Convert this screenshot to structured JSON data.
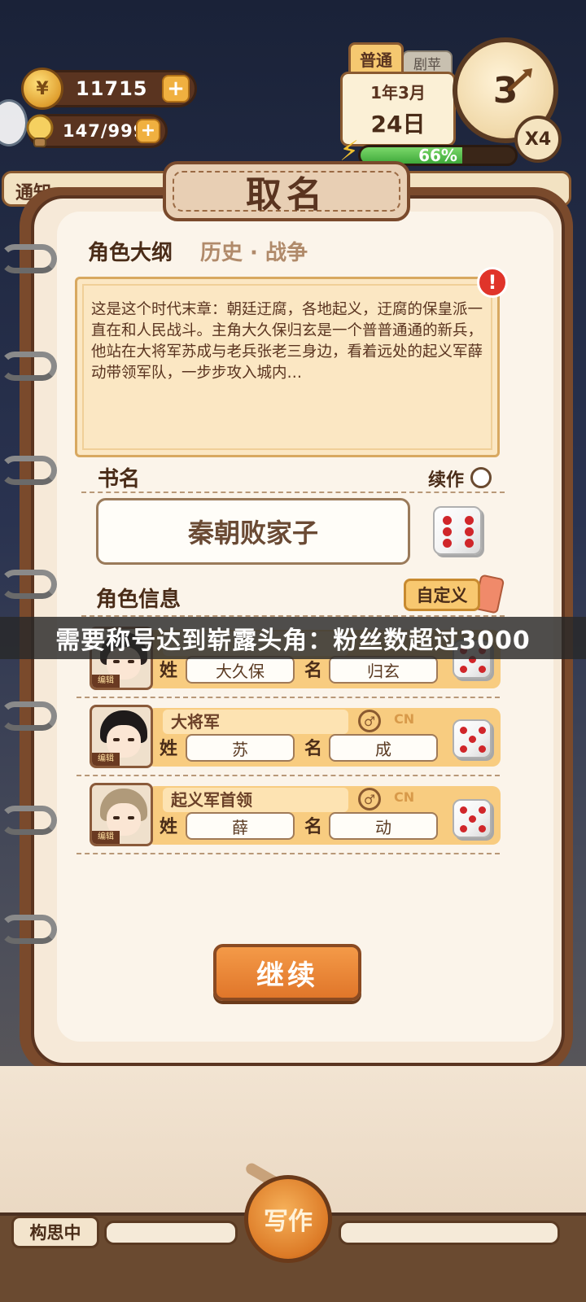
{
  "hud": {
    "coins": "11715",
    "coin_symbol": "¥",
    "energy": "147/999",
    "plus": "+",
    "mode_active": "普通",
    "mode_other": "剧苹",
    "date_line1": "1年3月",
    "date_line2": "24日",
    "progress_label": "66%",
    "progress_value": 0.66,
    "dial_number": "3",
    "speed": "X4",
    "notice_label": "通知"
  },
  "dialog": {
    "title": "取名",
    "outline_label": "角色大纲",
    "genre": "历史 · 战争",
    "alert": "!",
    "outline_text": "这是这个时代末章：朝廷迂腐，各地起义，迂腐的保皇派一直在和人民战斗。主角大久保归玄是一个普普通通的新兵，他站在大将军苏成与老兵张老三身边，看着远处的起义军薛动带领军队，一步步攻入城内…",
    "book_label": "书名",
    "sequel_label": "续作",
    "book_name": "秦朝败家子",
    "char_info_label": "角色信息",
    "custom_label": "自定义",
    "surname_label": "姓",
    "given_label": "名",
    "characters": [
      {
        "role": "",
        "gender": "♂",
        "lang": "CN",
        "surname": "大久保",
        "given": "归玄",
        "edit": "编辑"
      },
      {
        "role": "大将军",
        "gender": "♂",
        "lang": "CN",
        "surname": "苏",
        "given": "成",
        "edit": "编辑"
      },
      {
        "role": "起义军首领",
        "gender": "♂",
        "lang": "CN",
        "surname": "薛",
        "given": "动",
        "edit": "编辑"
      }
    ],
    "continue_label": "继续"
  },
  "toast": "需要称号达到崭露头角：粉丝数超过3000",
  "bottom": {
    "thinking_label": "构思中",
    "write_label": "写作"
  },
  "colors": {
    "accent_orange": "#e0762a",
    "notebook_brown": "#7a4a2c",
    "progress_green": "#3ea83a",
    "dice_pip_red": "#d0262a"
  },
  "icons": {
    "coin": "coin-icon",
    "energy": "lightbulb-icon",
    "dice": "dice-icon",
    "gender": "male-icon",
    "alert": "exclamation-icon"
  }
}
